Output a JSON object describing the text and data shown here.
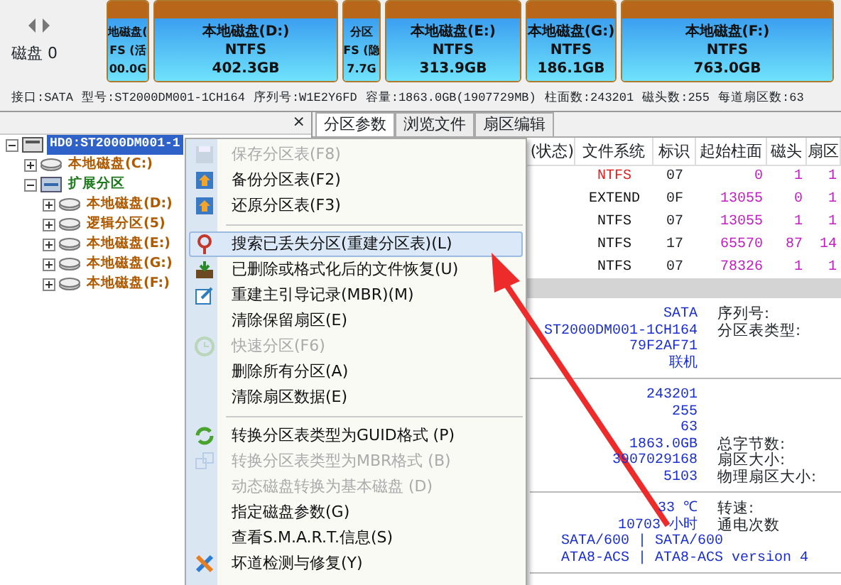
{
  "disk_nav": {
    "label": "磁盘 0"
  },
  "partitions": [
    {
      "name": "地磁盘(",
      "fs": "FS (活",
      "size": "00.0G"
    },
    {
      "name": "本地磁盘(D:)",
      "fs": "NTFS",
      "size": "402.3GB"
    },
    {
      "name": "分区",
      "fs": "FS (隐",
      "size": "7.7G"
    },
    {
      "name": "本地磁盘(E:)",
      "fs": "NTFS",
      "size": "313.9GB"
    },
    {
      "name": "本地磁盘(G:)",
      "fs": "NTFS",
      "size": "186.1GB"
    },
    {
      "name": "本地磁盘(F:)",
      "fs": "NTFS",
      "size": "763.0GB"
    }
  ],
  "disk_info": [
    "接口:SATA",
    "型号:ST2000DM001-1CH164",
    "序列号:W1E2Y6FD",
    "容量:1863.0GB(1907729MB)",
    "柱面数:243201",
    "磁头数:255",
    "每道扇区数:63"
  ],
  "tree_panel": {
    "close": "×"
  },
  "tree": [
    {
      "label": "HD0:ST2000DM001-1",
      "kind": "disk",
      "selected": true,
      "expanded": true,
      "children": [
        {
          "label": "本地磁盘(C:)",
          "kind": "volume",
          "selected": false,
          "expanded": false
        },
        {
          "label": "扩展分区",
          "kind": "extended",
          "selected": false,
          "expanded": true,
          "children": [
            {
              "label": "本地磁盘(D:)",
              "kind": "volume",
              "selected": false,
              "expanded": false
            },
            {
              "label": "逻辑分区(5)",
              "kind": "volume",
              "selected": false,
              "expanded": false
            },
            {
              "label": "本地磁盘(E:)",
              "kind": "volume",
              "selected": false,
              "expanded": false
            },
            {
              "label": "本地磁盘(G:)",
              "kind": "volume",
              "selected": false,
              "expanded": false
            },
            {
              "label": "本地磁盘(F:)",
              "kind": "volume",
              "selected": false,
              "expanded": false
            }
          ]
        }
      ]
    }
  ],
  "tabs": [
    {
      "label": "分区参数",
      "selected": true
    },
    {
      "label": "浏览文件",
      "selected": false
    },
    {
      "label": "扇区编辑",
      "selected": false
    }
  ],
  "table": {
    "columns": [
      "(状态)",
      "文件系统",
      "标识",
      "起始柱面",
      "磁头",
      "扇区"
    ],
    "rows": [
      {
        "active": true,
        "cells": [
          "",
          "NTFS",
          "07",
          "0",
          "1",
          "1"
        ]
      },
      {
        "active": false,
        "cells": [
          "",
          "EXTEND",
          "0F",
          "13055",
          "0",
          "1"
        ]
      },
      {
        "active": false,
        "cells": [
          "",
          "NTFS",
          "07",
          "13055",
          "1",
          "1"
        ]
      },
      {
        "active": false,
        "cells": [
          "",
          "NTFS",
          "17",
          "65570",
          "87",
          "14"
        ]
      },
      {
        "active": false,
        "cells": [
          "",
          "NTFS",
          "07",
          "78326",
          "1",
          "1"
        ]
      }
    ]
  },
  "details": [
    [
      {
        "value": "SATA",
        "label": "序列号:"
      },
      {
        "value": "ST2000DM001-1CH164",
        "label": "分区表类型:"
      },
      {
        "value": "79F2AF71"
      },
      {
        "value": "联机"
      }
    ],
    [
      {
        "value": "243201"
      },
      {
        "value": "255"
      },
      {
        "value": "63"
      },
      {
        "value": "1863.0GB",
        "label": "总字节数:"
      },
      {
        "value": "3907029168",
        "label": "扇区大小:"
      },
      {
        "value": "5103",
        "label": "物理扇区大小:"
      }
    ],
    [
      {
        "value": "33 ℃",
        "label": "转速:"
      },
      {
        "value": "10703 小时",
        "label": "通电次数"
      },
      {
        "line": "SATA/600 | SATA/600"
      },
      {
        "line": "ATA8-ACS | ATA8-ACS version 4"
      }
    ]
  ],
  "context_menu": [
    {
      "kind": "item",
      "label": "保存分区表(F8)",
      "disabled": true,
      "selected": false
    },
    {
      "kind": "item",
      "label": "备份分区表(F2)",
      "disabled": false,
      "selected": false
    },
    {
      "kind": "item",
      "label": "还原分区表(F3)",
      "disabled": false,
      "selected": false
    },
    {
      "kind": "separator"
    },
    {
      "kind": "item",
      "label": "搜索已丢失分区(重建分区表)(L)",
      "disabled": false,
      "selected": true
    },
    {
      "kind": "item",
      "label": "已删除或格式化后的文件恢复(U)",
      "disabled": false,
      "selected": false
    },
    {
      "kind": "item",
      "label": "重建主引导记录(MBR)(M)",
      "disabled": false,
      "selected": false
    },
    {
      "kind": "item",
      "label": "清除保留扇区(E)",
      "disabled": false,
      "selected": false
    },
    {
      "kind": "item",
      "label": "快速分区(F6)",
      "disabled": true,
      "selected": false
    },
    {
      "kind": "item",
      "label": "删除所有分区(A)",
      "disabled": false,
      "selected": false
    },
    {
      "kind": "item",
      "label": "清除扇区数据(E)",
      "disabled": false,
      "selected": false
    },
    {
      "kind": "separator"
    },
    {
      "kind": "item",
      "label": "转换分区表类型为GUID格式 (P)",
      "disabled": false,
      "selected": false
    },
    {
      "kind": "item",
      "label": "转换分区表类型为MBR格式 (B)",
      "disabled": true,
      "selected": false
    },
    {
      "kind": "item",
      "label": "动态磁盘转换为基本磁盘 (D)",
      "disabled": true,
      "selected": false
    },
    {
      "kind": "item",
      "label": "指定磁盘参数(G)",
      "disabled": false,
      "selected": false
    },
    {
      "kind": "item",
      "label": "查看S.M.A.R.T.信息(S)",
      "disabled": false,
      "selected": false
    },
    {
      "kind": "item",
      "label": "坏道检测与修复(Y)",
      "disabled": false,
      "selected": false
    }
  ]
}
